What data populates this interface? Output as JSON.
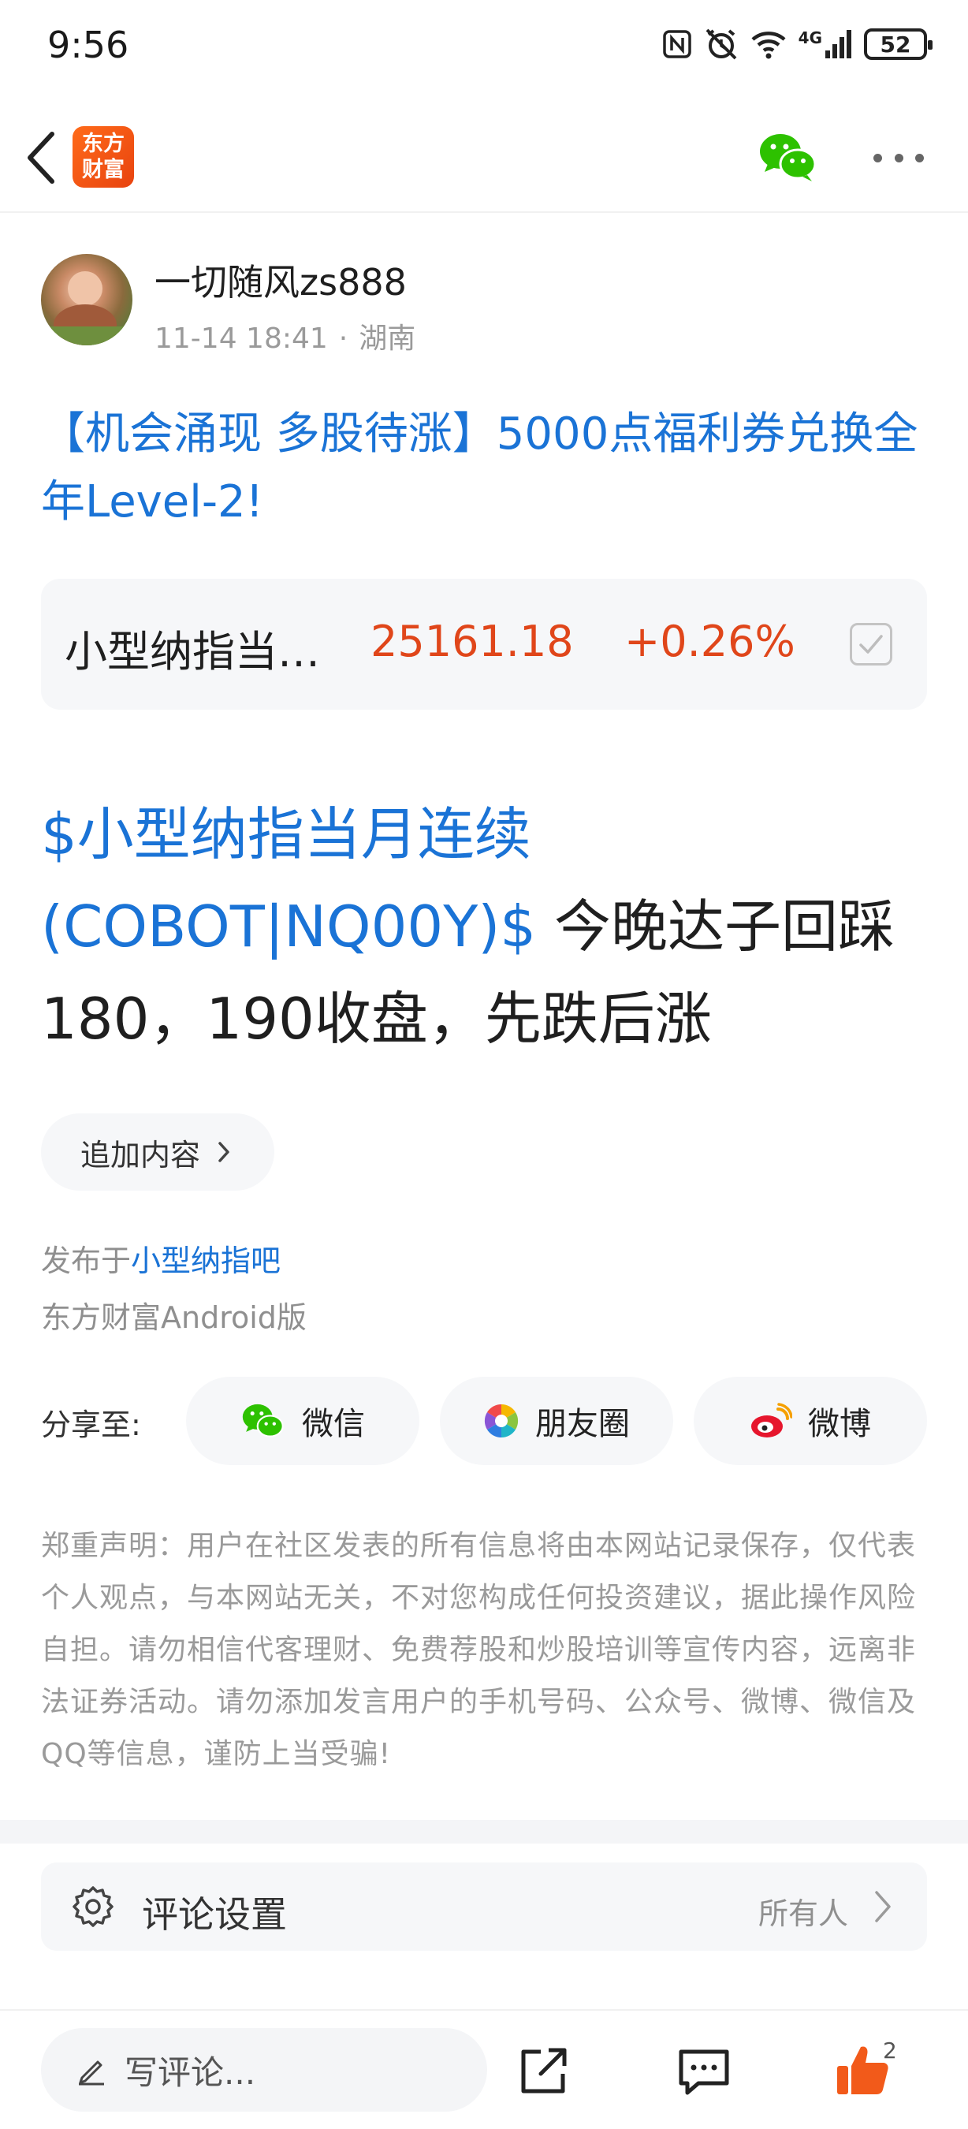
{
  "status_bar": {
    "time": "9:56",
    "network": "4G",
    "battery": "52"
  },
  "header": {
    "logo_text_line1": "东方",
    "logo_text_line2": "财富",
    "accent_color": "#e8430f"
  },
  "author": {
    "name": "一切随风zs888",
    "datetime": "11-14 18:41",
    "separator": "·",
    "location": "湖南"
  },
  "promo_title": "【机会涌现 多股待涨】5000点福利券兑换全年Level-2!",
  "stock": {
    "name": "小型纳指当…",
    "price": "25161.18",
    "change": "+0.26%",
    "color": "#e0461a"
  },
  "post": {
    "tag": "$小型纳指当月连续(COBOT|NQ00Y)$",
    "text": " 今晚达子回踩180，190收盘，先跌后涨"
  },
  "add_content_label": "追加内容",
  "published": {
    "prefix": "发布于",
    "forum": "小型纳指吧"
  },
  "client_version": "东方财富Android版",
  "share": {
    "label": "分享至:",
    "wechat": "微信",
    "moments": "朋友圈",
    "weibo": "微博"
  },
  "disclaimer": "郑重声明：用户在社区发表的所有信息将由本网站记录保存，仅代表个人观点，与本网站无关，不对您构成任何投资建议，据此操作风险自担。请勿相信代客理财、免费荐股和炒股培训等宣传内容，远离非法证券活动。请勿添加发言用户的手机号码、公众号、微博、微信及QQ等信息，谨防上当受骗!",
  "comment_settings": {
    "label": "评论设置",
    "value": "所有人"
  },
  "bottom_bar": {
    "comment_placeholder": "写评论...",
    "like_count": "2",
    "like_color": "#f25a1a"
  }
}
